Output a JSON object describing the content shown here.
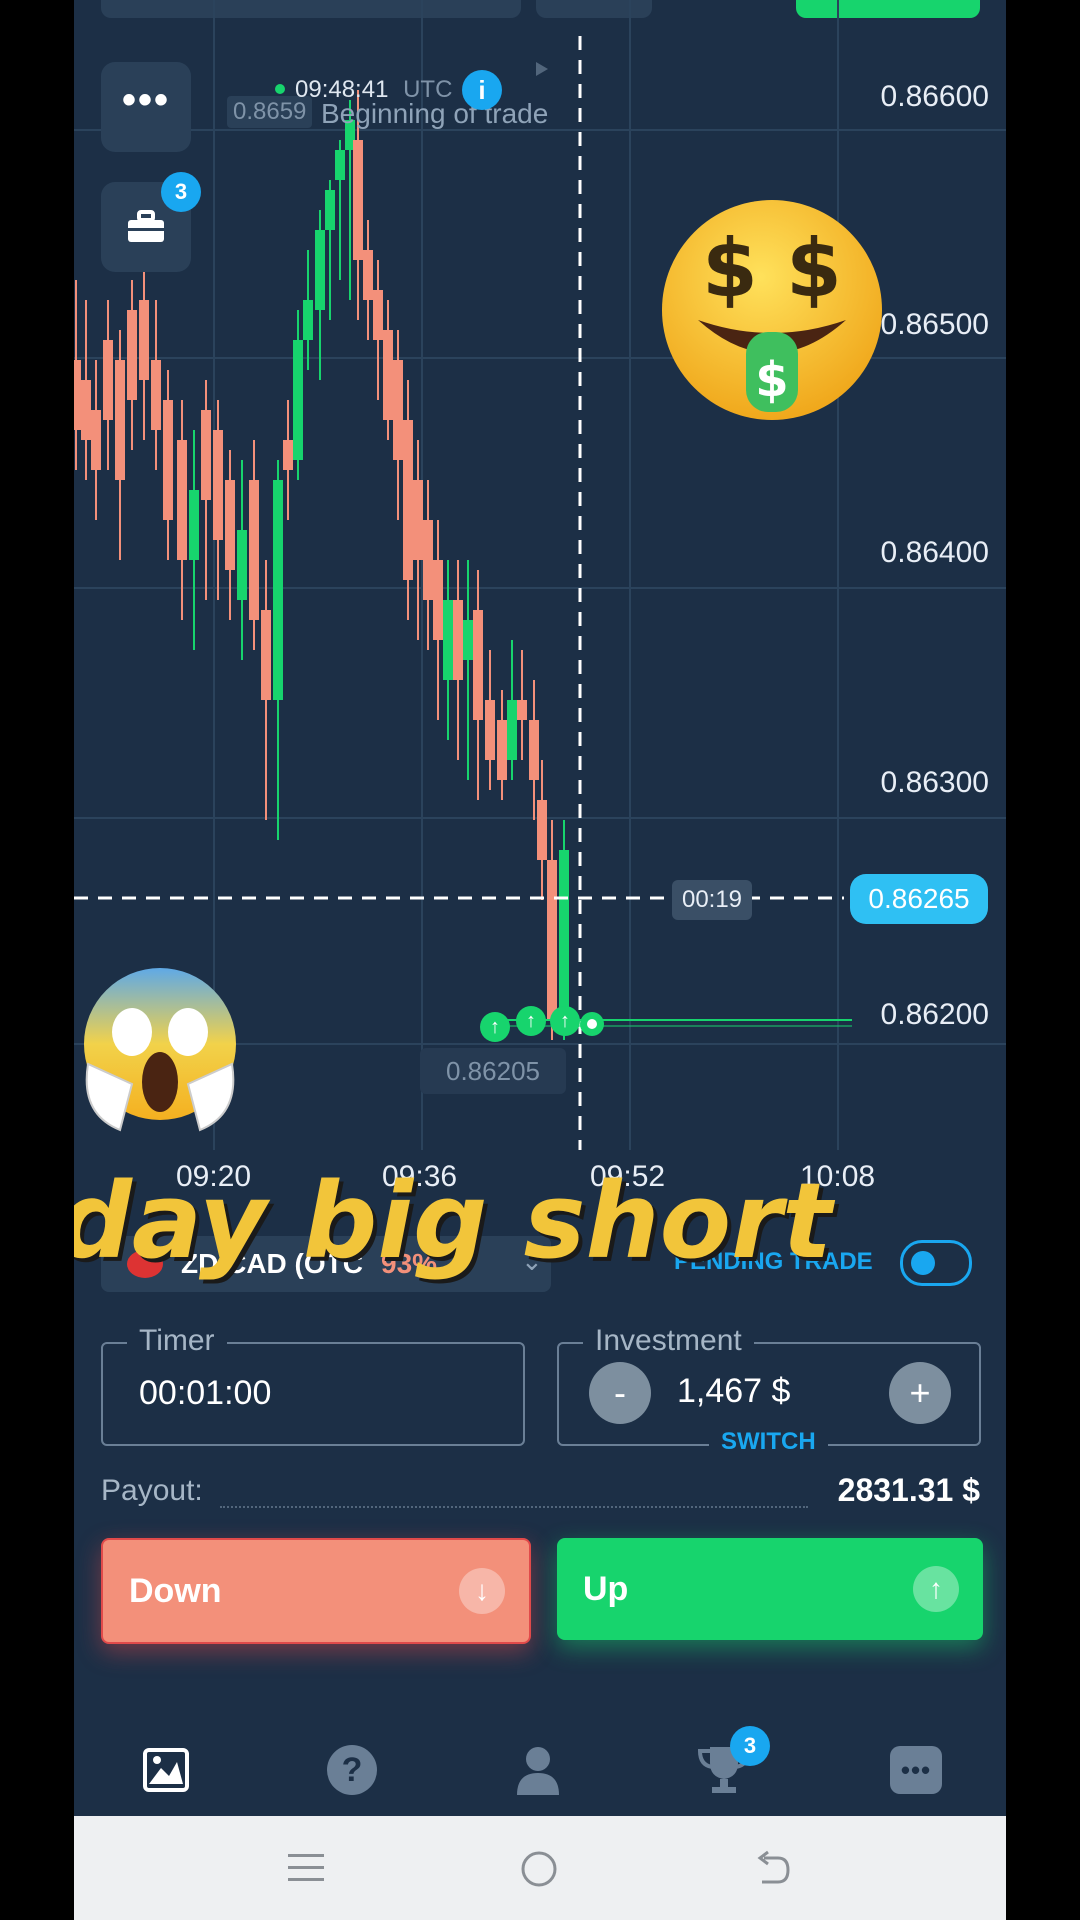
{
  "timeline": {
    "time": "09:48:41",
    "tz": "UTC",
    "beginning_label": "Beginning of trade",
    "faded_price": "0.8659"
  },
  "price_axis": [
    "0.86600",
    "0.86500",
    "0.86400",
    "0.86300",
    "0.86200"
  ],
  "current_price": "0.86265",
  "countdown": "00:19",
  "entry_price": "0.86205",
  "time_axis": [
    "09:20",
    "09:36",
    "09:52",
    "10:08"
  ],
  "portfolio_badge": "3",
  "overlay_caption": "oday big short",
  "asset": {
    "pair": "ZD/CAD (OTC",
    "payout_pct": "93%"
  },
  "pending_trade_label": "PENDING TRADE",
  "timer": {
    "label": "Timer",
    "value": "00:01:00"
  },
  "investment": {
    "label": "Investment",
    "value": "1,467 $",
    "minus": "-",
    "plus": "+",
    "switch": "SWITCH"
  },
  "payout": {
    "label": "Payout:",
    "value": "2831.31 $"
  },
  "down_label": "Down",
  "up_label": "Up",
  "nav_badge": "3",
  "colors": {
    "background": "#1c2f46",
    "up": "#17d46d",
    "down": "#f3907a",
    "accent": "#19a7f0",
    "price_badge": "#2fc0f3"
  },
  "icons": [
    "menu-dots-icon",
    "briefcase-icon",
    "info-icon",
    "chart-icon",
    "help-icon",
    "user-icon",
    "trophy-icon",
    "more-icon",
    "arrow-up-icon",
    "arrow-down-icon",
    "money-face-emoji",
    "screaming-face-emoji",
    "android-recents-icon",
    "android-home-icon",
    "android-back-icon"
  ]
}
